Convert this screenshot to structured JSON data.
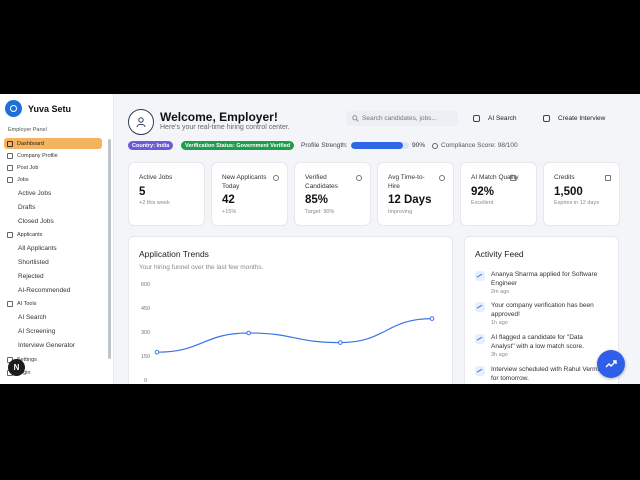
{
  "brand": {
    "name": "Yuva Setu"
  },
  "sidebar": {
    "panel_label": "Employer Panel",
    "items": [
      {
        "label": "Dashboard",
        "icon": "dashboard-icon",
        "active": true
      },
      {
        "label": "Company Profile",
        "icon": "building-icon"
      },
      {
        "label": "Post Job",
        "icon": "plus-icon"
      }
    ],
    "jobs": {
      "label": "Jobs",
      "children": [
        "Active Jobs",
        "Drafts",
        "Closed Jobs"
      ]
    },
    "applicants": {
      "label": "Applicants",
      "children": [
        "All Applicants",
        "Shortlisted",
        "Rejected",
        "AI-Recommended"
      ]
    },
    "ai_tools": {
      "label": "AI Tools",
      "children": [
        "AI Search",
        "AI Screening",
        "Interview Generator"
      ]
    },
    "settings": "Settings",
    "login": "Login",
    "badge": "N"
  },
  "header": {
    "title": "Welcome, Employer!",
    "subtitle": "Here's your real-time hiring control center.",
    "search_placeholder": "Search candidates, jobs...",
    "ai_search": "AI Search",
    "create_interview": "Create Interview"
  },
  "status": {
    "country": "Country: India",
    "verification": "Verification Status: Government Verified",
    "strength_label": "Profile Strength:",
    "strength_value": "90%",
    "strength_fraction": 0.9,
    "compliance": "Compliance Score: 98/100",
    "colors": {
      "country": "#6b5bd6",
      "verification": "#1f9d4c",
      "strength": "#2f67e6"
    }
  },
  "stats": [
    {
      "label": "Active Jobs",
      "value": "5",
      "sub": "+2 this week",
      "icon": "briefcase-icon"
    },
    {
      "label": "New Applicants Today",
      "value": "42",
      "sub": "+15%",
      "icon": "users-icon"
    },
    {
      "label": "Verified Candidates",
      "value": "85%",
      "sub": "Target: 90%",
      "icon": "check-circle-icon"
    },
    {
      "label": "Avg Time-to-Hire",
      "value": "12 Days",
      "sub": "Improving",
      "icon": "clock-icon"
    },
    {
      "label": "AI Match Quality",
      "value": "92%",
      "sub": "Excellent",
      "icon": "robot-icon"
    },
    {
      "label": "Credits",
      "value": "1,500",
      "sub": "Expires in 12 days",
      "icon": "credit-card-icon"
    }
  ],
  "trends": {
    "title": "Application Trends",
    "subtitle": "Your hiring funnel over the last few months."
  },
  "chart_data": {
    "type": "line",
    "y_ticks": [
      "600",
      "450",
      "300",
      "150",
      "0"
    ],
    "ylim": [
      0,
      600
    ],
    "values": [
      180,
      300,
      240,
      390
    ],
    "color": "#3b74e8"
  },
  "feed": {
    "title": "Activity Feed",
    "items": [
      {
        "text": "Ananya Sharma applied for Software Engineer",
        "time": "2m ago"
      },
      {
        "text": "Your company verification has been approved!",
        "time": "1h ago"
      },
      {
        "text": "AI flagged a candidate for \"Data Analyst\" with a low match score.",
        "time": "3h ago"
      },
      {
        "text": "Interview scheduled with Rahul Verma for tomorrow.",
        "time": ""
      }
    ]
  }
}
